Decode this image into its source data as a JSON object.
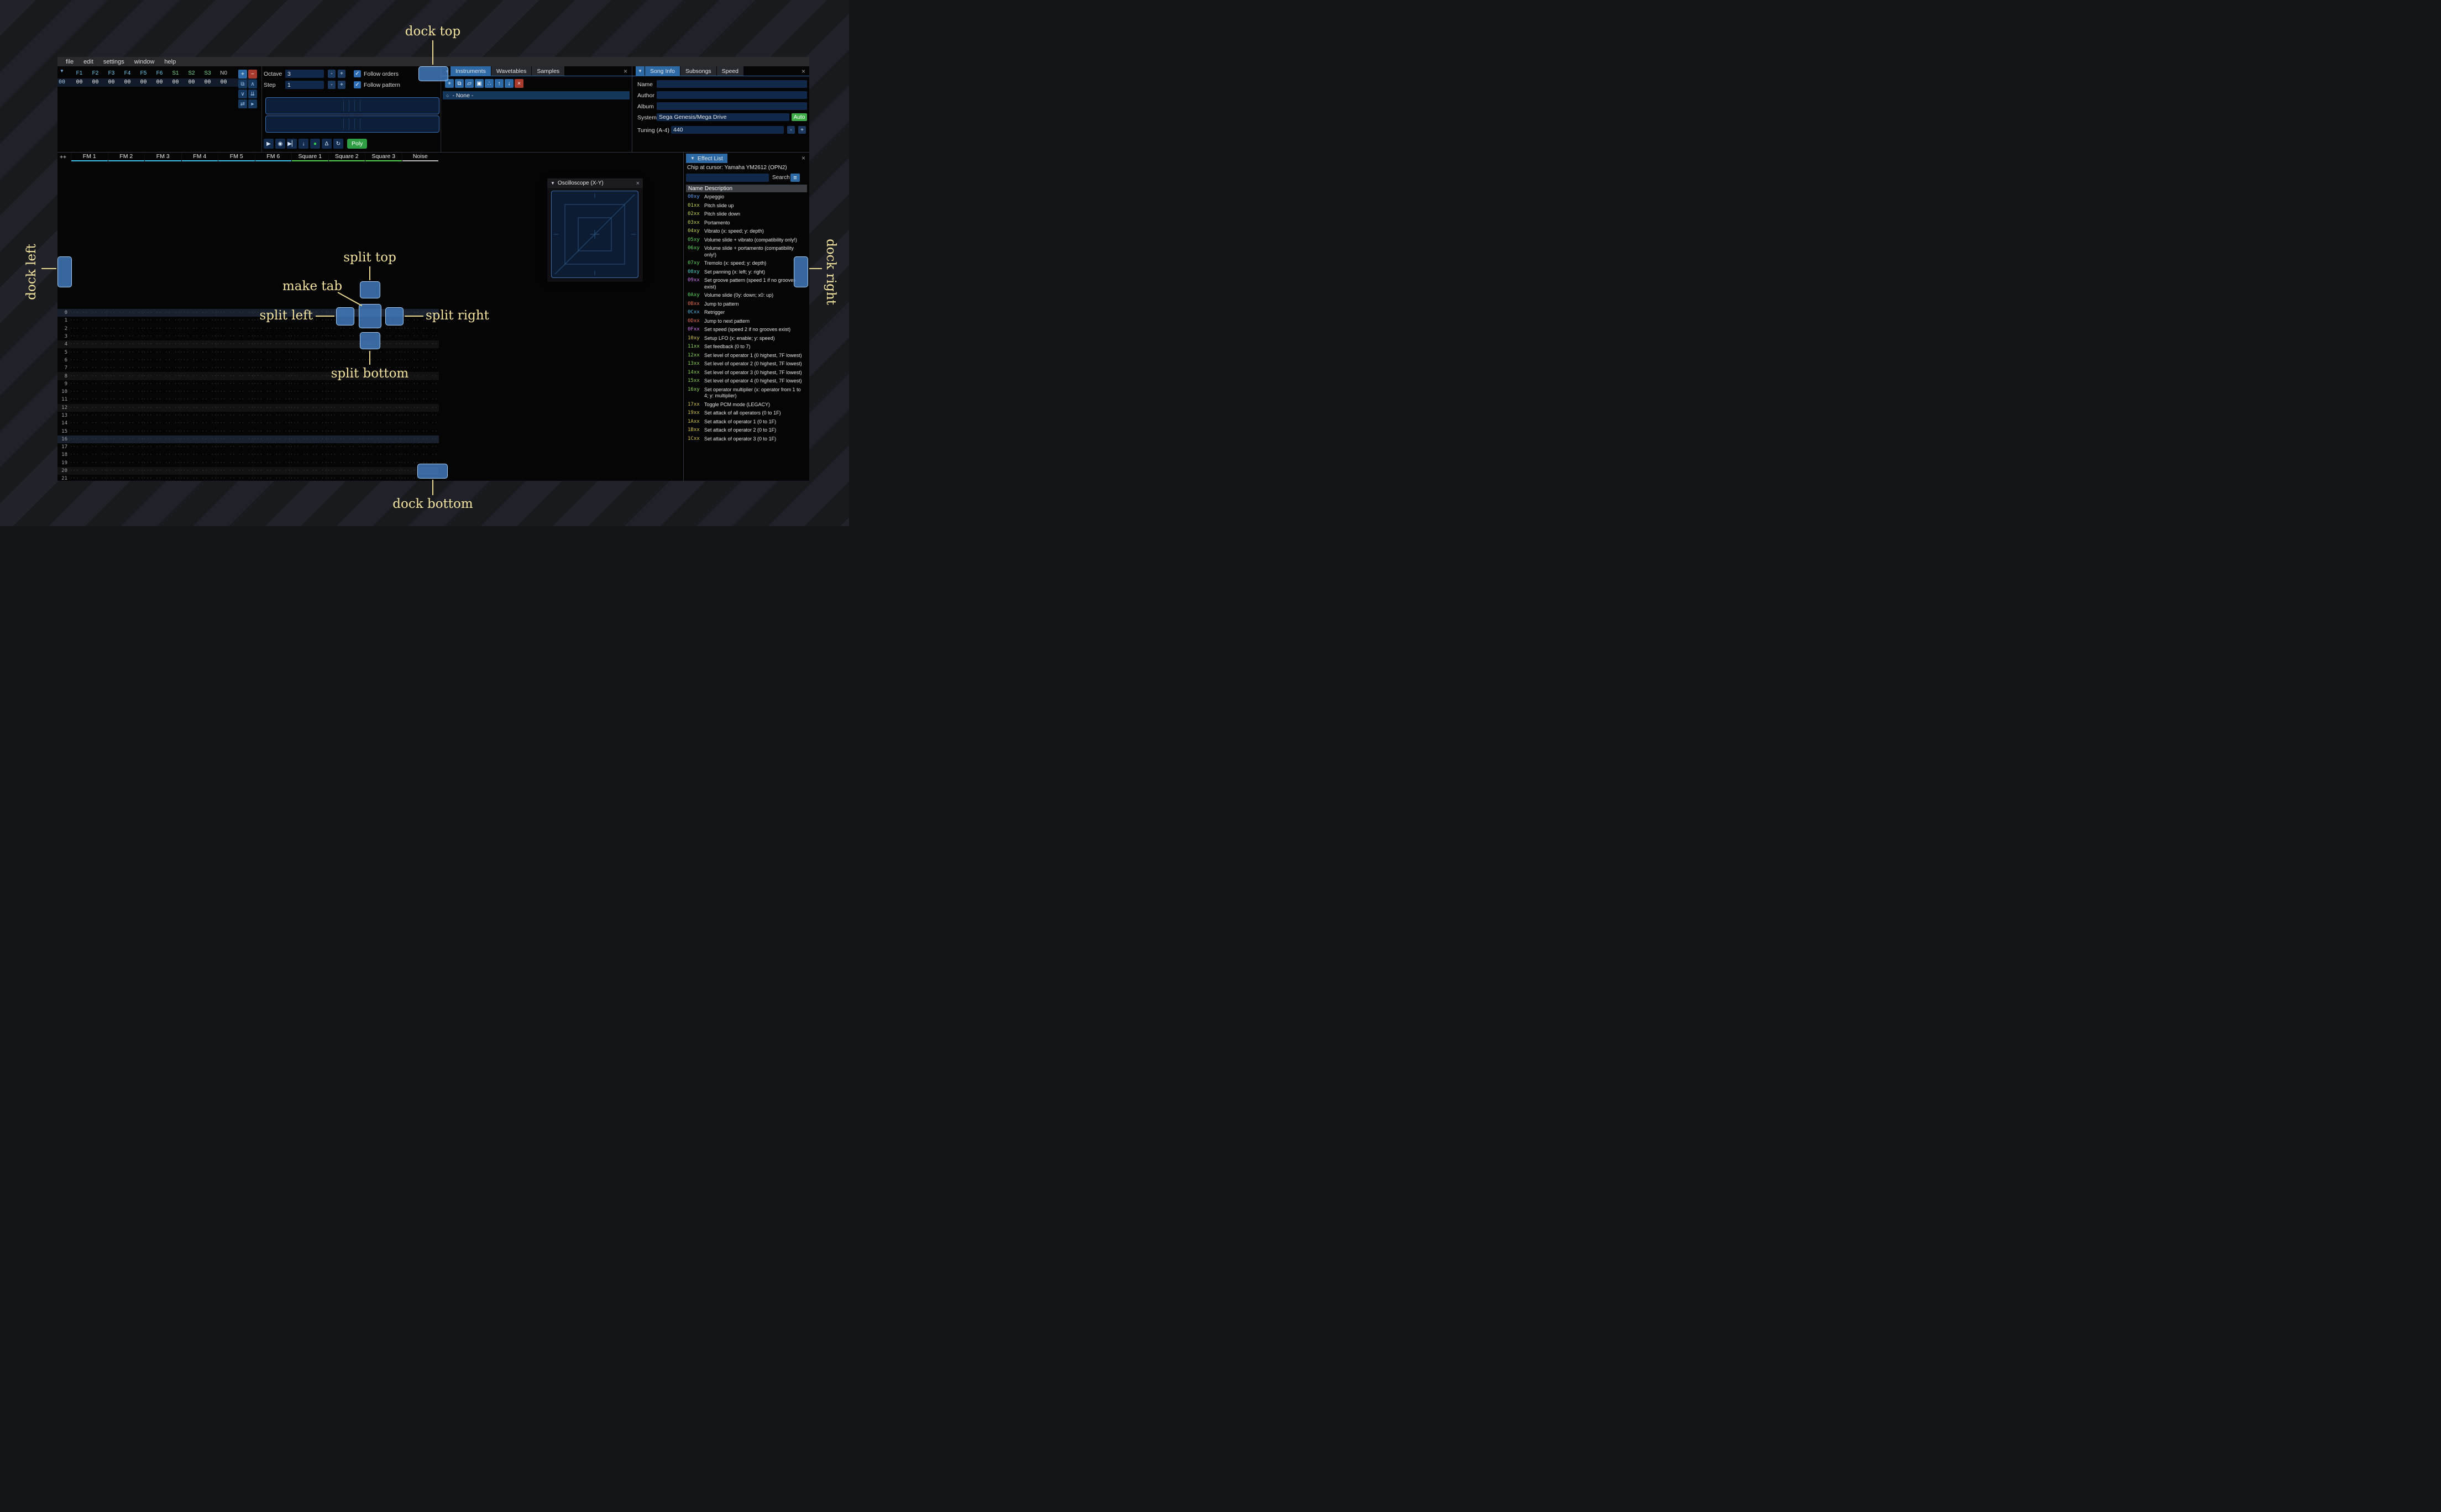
{
  "colors": {
    "accent": "#2d69a5",
    "dock_indicator": "#4c86c2",
    "annotation": "#f3e3a0",
    "record_green": "#39d353",
    "poly_green": "#2f9e44",
    "auto_green": "#3fae4a",
    "delete_red": "#a83a2e",
    "fm_channel": "#3fc3f0",
    "square_channel": "#52d452",
    "noise_channel": "#bcbcbc"
  },
  "menu": [
    "file",
    "edit",
    "settings",
    "window",
    "help"
  ],
  "orders": {
    "columns": [
      {
        "label": "F1",
        "color": "#74c8e8"
      },
      {
        "label": "F2",
        "color": "#74c8e8"
      },
      {
        "label": "F3",
        "color": "#74c8e8"
      },
      {
        "label": "F4",
        "color": "#74c8e8"
      },
      {
        "label": "F5",
        "color": "#74c8e8"
      },
      {
        "label": "F6",
        "color": "#74c8e8"
      },
      {
        "label": "S1",
        "color": "#7fd88f"
      },
      {
        "label": "S2",
        "color": "#7fd88f"
      },
      {
        "label": "S3",
        "color": "#7fd88f"
      },
      {
        "label": "N0",
        "color": "#c8c8c8"
      }
    ],
    "row": {
      "index": "00",
      "values": [
        "00",
        "00",
        "00",
        "00",
        "00",
        "00",
        "00",
        "00",
        "00",
        "00"
      ]
    },
    "buttons": [
      {
        "name": "order-add-button",
        "glyph": "+",
        "style": "blue"
      },
      {
        "name": "order-remove-button",
        "glyph": "−",
        "style": "red"
      },
      {
        "name": "order-duplicate-button",
        "glyph": "⧉",
        "style": "dark"
      },
      {
        "name": "order-move-up-button",
        "glyph": "∧",
        "style": "dark"
      },
      {
        "name": "order-move-down-button",
        "glyph": "∨",
        "style": "dark"
      },
      {
        "name": "order-duplicate-end-button",
        "glyph": "⇊",
        "style": "dark"
      },
      {
        "name": "order-change-all-button",
        "glyph": "⇄",
        "style": "dark"
      },
      {
        "name": "order-edit-mode-button",
        "glyph": "▸",
        "style": "dark"
      }
    ]
  },
  "controls": {
    "octave_label": "Octave",
    "octave_value": "3",
    "step_label": "Step",
    "step_value": "1",
    "minus": "-",
    "plus": "+",
    "follow_orders": "Follow orders",
    "follow_pattern": "Follow pattern",
    "poly_label": "Poly"
  },
  "transport_buttons": [
    {
      "name": "play-button",
      "glyph": "▶"
    },
    {
      "name": "play-pattern-button",
      "glyph": "◉"
    },
    {
      "name": "play-from-cursor-button",
      "glyph": "▶▏"
    },
    {
      "name": "step-one-row-button",
      "glyph": "↓"
    },
    {
      "name": "record-button",
      "glyph": "●",
      "glyph_color": "#39d353"
    },
    {
      "name": "metronome-button",
      "glyph": "Δ"
    },
    {
      "name": "repeat-pattern-button",
      "glyph": "↻"
    }
  ],
  "instruments_panel": {
    "tabs": [
      "Instruments",
      "Wavetables",
      "Samples"
    ],
    "selected_tab": 0,
    "toolbar": [
      {
        "name": "add-instrument-button",
        "glyph": "+",
        "style": "blue"
      },
      {
        "name": "duplicate-instrument-button",
        "glyph": "⧉",
        "style": "blue"
      },
      {
        "name": "open-instrument-button",
        "glyph": "▱",
        "style": "blue"
      },
      {
        "name": "save-instrument-button",
        "glyph": "▣",
        "style": "blue"
      },
      {
        "name": "instrument-dir-view-button",
        "glyph": "∴",
        "style": "blue"
      },
      {
        "name": "move-instrument-up-button",
        "glyph": "↑",
        "style": "blue"
      },
      {
        "name": "move-instrument-down-button",
        "glyph": "↓",
        "style": "blue"
      },
      {
        "name": "delete-instrument-button",
        "glyph": "×",
        "style": "red"
      }
    ],
    "list": [
      {
        "label": "- None -",
        "selected": true
      }
    ]
  },
  "song_info": {
    "tabs": [
      "Song Info",
      "Subsongs",
      "Speed"
    ],
    "selected_tab": 0,
    "fields": [
      {
        "label": "Name",
        "value": ""
      },
      {
        "label": "Author",
        "value": ""
      },
      {
        "label": "Album",
        "value": ""
      }
    ],
    "system_label": "System",
    "system_value": "Sega Genesis/Mega Drive",
    "auto_button": "Auto",
    "tuning_label": "Tuning (A-4)",
    "tuning_value": "440"
  },
  "pattern": {
    "corner": "++",
    "row_count": 22,
    "empty_cell": "··· ·· ·· ···",
    "channels": [
      {
        "name": "FM 1",
        "color": "#3fc3f0"
      },
      {
        "name": "FM 2",
        "color": "#3fc3f0"
      },
      {
        "name": "FM 3",
        "color": "#3fc3f0"
      },
      {
        "name": "FM 4",
        "color": "#3fc3f0"
      },
      {
        "name": "FM 5",
        "color": "#3fc3f0"
      },
      {
        "name": "FM 6",
        "color": "#3fc3f0"
      },
      {
        "name": "Square 1",
        "color": "#52d452"
      },
      {
        "name": "Square 2",
        "color": "#52d452"
      },
      {
        "name": "Square 3",
        "color": "#52d452"
      },
      {
        "name": "Noise",
        "color": "#bcbcbc"
      }
    ]
  },
  "oscilloscope": {
    "title": "Oscilloscope (X-Y)"
  },
  "effect_list": {
    "title": "Effect List",
    "chip_line": "Chip at cursor: Yamaha YM2612 (OPN2)",
    "search_label": "Search",
    "columns": {
      "name": "Name",
      "description": "Description"
    },
    "effects": [
      {
        "code": "00xy",
        "color": "#5e9ef0",
        "desc": "Arpeggio"
      },
      {
        "code": "01xx",
        "color": "#c9d455",
        "desc": "Pitch slide up"
      },
      {
        "code": "02xx",
        "color": "#c9d455",
        "desc": "Pitch slide down"
      },
      {
        "code": "03xx",
        "color": "#c9d455",
        "desc": "Portamento"
      },
      {
        "code": "04xy",
        "color": "#c9d455",
        "desc": "Vibrato (x: speed; y: depth)"
      },
      {
        "code": "05xy",
        "color": "#5bd65b",
        "desc": "Volume slide + vibrato (compatibility only!)"
      },
      {
        "code": "06xy",
        "color": "#5bd65b",
        "desc": "Volume slide + portamento (compatibility only!)"
      },
      {
        "code": "07xy",
        "color": "#5bd65b",
        "desc": "Tremolo (x: speed; y: depth)"
      },
      {
        "code": "08xy",
        "color": "#4fd2c8",
        "desc": "Set panning (x: left; y: right)"
      },
      {
        "code": "09xx",
        "color": "#c973e8",
        "desc": "Set groove pattern (speed 1 if no grooves exist)"
      },
      {
        "code": "0Axy",
        "color": "#5bd65b",
        "desc": "Volume slide (0y: down; x0: up)"
      },
      {
        "code": "0Bxx",
        "color": "#e26a50",
        "desc": "Jump to pattern"
      },
      {
        "code": "0Cxx",
        "color": "#52b4e0",
        "desc": "Retrigger"
      },
      {
        "code": "0Dxx",
        "color": "#e26a50",
        "desc": "Jump to next pattern"
      },
      {
        "code": "0Fxx",
        "color": "#c973e8",
        "desc": "Set speed (speed 2 if no grooves exist)"
      },
      {
        "code": "10xy",
        "color": "#d4c455",
        "desc": "Setup LFO (x: enable; y: speed)"
      },
      {
        "code": "11xx",
        "color": "#8ad455",
        "desc": "Set feedback (0 to 7)"
      },
      {
        "code": "12xx",
        "color": "#8ad455",
        "desc": "Set level of operator 1 (0 highest, 7F lowest)"
      },
      {
        "code": "13xx",
        "color": "#8ad455",
        "desc": "Set level of operator 2 (0 highest, 7F lowest)"
      },
      {
        "code": "14xx",
        "color": "#8ad455",
        "desc": "Set level of operator 3 (0 highest, 7F lowest)"
      },
      {
        "code": "15xx",
        "color": "#8ad455",
        "desc": "Set level of operator 4 (0 highest, 7F lowest)"
      },
      {
        "code": "16xy",
        "color": "#8ad455",
        "desc": "Set operator multiplier (x: operator from 1 to 4; y: multiplier)"
      },
      {
        "code": "17xx",
        "color": "#d4c455",
        "desc": "Toggle PCM mode (LEGACY)"
      },
      {
        "code": "19xx",
        "color": "#d4c455",
        "desc": "Set attack of all operators (0 to 1F)"
      },
      {
        "code": "1Axx",
        "color": "#d4c455",
        "desc": "Set attack of operator 1 (0 to 1F)"
      },
      {
        "code": "1Bxx",
        "color": "#d4c455",
        "desc": "Set attack of operator 2 (0 to 1F)"
      },
      {
        "code": "1Cxx",
        "color": "#d4c455",
        "desc": "Set attack of operator 3 (0 to 1F)"
      }
    ]
  },
  "annotations": {
    "dock_top": "dock top",
    "dock_bottom": "dock bottom",
    "dock_left": "dock left",
    "dock_right": "dock right",
    "split_top": "split top",
    "split_bottom": "split bottom",
    "split_left": "split left",
    "split_right": "split right",
    "make_tab": "make tab"
  },
  "icons": {
    "close": "×",
    "collapse": "▼",
    "tab_list": "▼",
    "radio": "○",
    "hamburger": "≡",
    "check": "✓"
  }
}
